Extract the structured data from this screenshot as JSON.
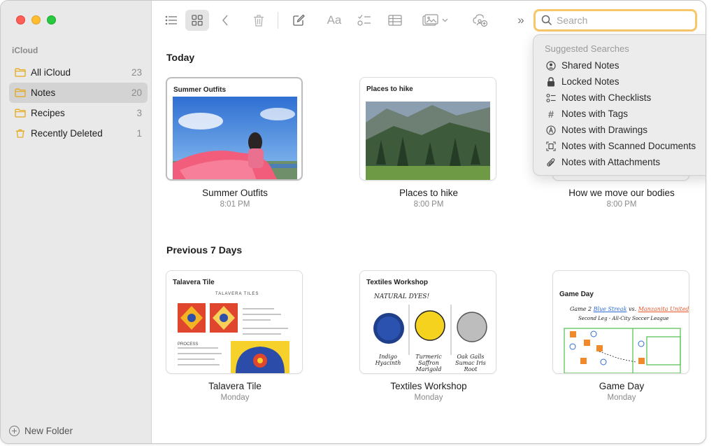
{
  "sidebar": {
    "section_label": "iCloud",
    "items": [
      {
        "label": "All iCloud",
        "count": "23"
      },
      {
        "label": "Notes",
        "count": "20"
      },
      {
        "label": "Recipes",
        "count": "3"
      },
      {
        "label": "Recently Deleted",
        "count": "1"
      }
    ],
    "new_folder_label": "New Folder"
  },
  "toolbar": {
    "text_format_label": "Aa",
    "more_label": "»"
  },
  "search": {
    "placeholder": "Search",
    "value": ""
  },
  "suggested": {
    "header": "Suggested Searches",
    "items": [
      {
        "label": "Shared Notes",
        "icon": "person-circle-icon"
      },
      {
        "label": "Locked Notes",
        "icon": "lock-icon"
      },
      {
        "label": "Notes with Checklists",
        "icon": "checklist-icon"
      },
      {
        "label": "Notes with Tags",
        "icon": "hashtag-icon"
      },
      {
        "label": "Notes with Drawings",
        "icon": "pencil-tip-icon"
      },
      {
        "label": "Notes with Scanned Documents",
        "icon": "doc-scan-icon"
      },
      {
        "label": "Notes with Attachments",
        "icon": "paperclip-icon"
      }
    ]
  },
  "sections": {
    "today": "Today",
    "previous": "Previous 7 Days"
  },
  "notes": {
    "today": [
      {
        "title": "Summer Outfits",
        "thumb_title": "Summer Outfits",
        "time": "8:01 PM"
      },
      {
        "title": "Places to hike",
        "thumb_title": "Places to hike",
        "time": "8:00 PM"
      },
      {
        "title": "How we move our bodies",
        "thumb_title": "",
        "time": "8:00 PM"
      }
    ],
    "previous": [
      {
        "title": "Talavera Tile",
        "thumb_title": "Talavera Tile",
        "time": "Monday",
        "thumb_heading": "TALAVERA TILES",
        "thumb_process": "PROCESS"
      },
      {
        "title": "Textiles Workshop",
        "thumb_title": "Textiles Workshop",
        "time": "Monday",
        "thumb_heading": "NATURAL DYES!",
        "dyes": [
          "Indigo Hyacinth",
          "Turmeric Saffron Marigold",
          "Oak Galls Sumac Iris Root"
        ]
      },
      {
        "title": "Game Day",
        "thumb_title": "Game Day",
        "time": "Monday",
        "thumb_heading": "Game 2",
        "team_a": "Blue Streak",
        "vs": "vs.",
        "team_b": "Manzanita United",
        "thumb_sub": "Second Leg - All-City Soccer League"
      }
    ]
  },
  "colors": {
    "folder": "#e6a817",
    "search_focus": "#f7c76a",
    "team_a": "#2d6bd8",
    "team_b": "#e8562a"
  }
}
